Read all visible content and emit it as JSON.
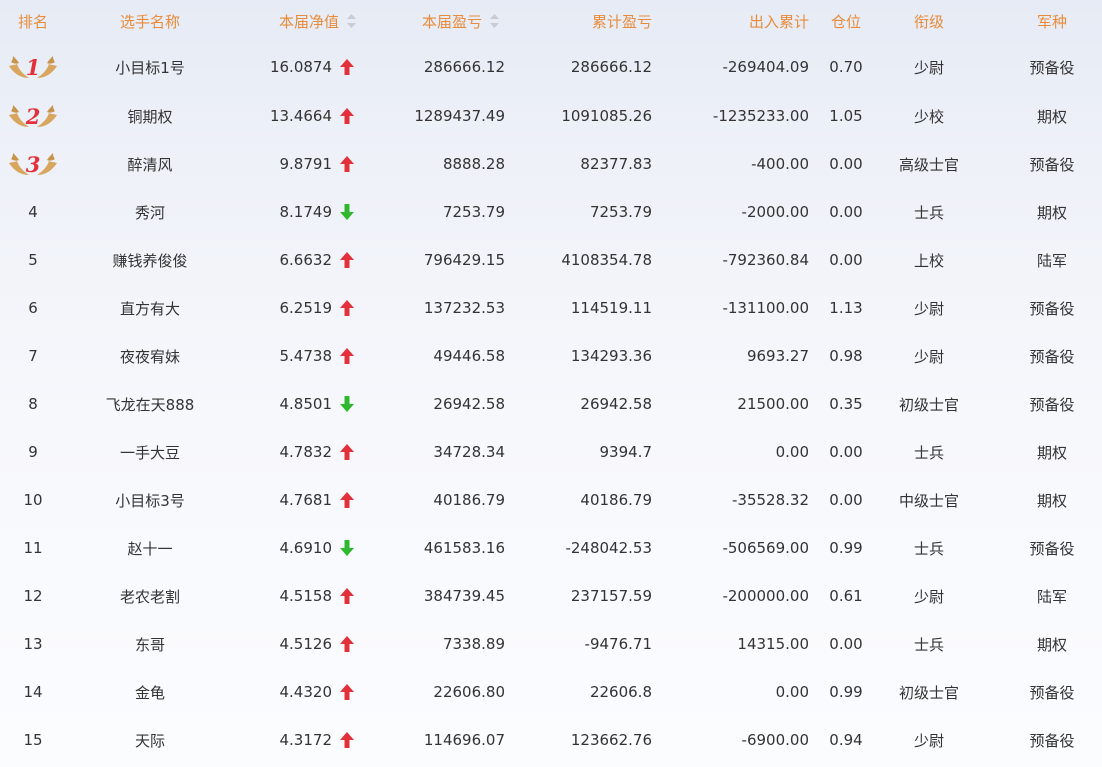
{
  "header": {
    "rank": "排名",
    "name": "选手名称",
    "nav": "本届净值",
    "profit": "本届盈亏",
    "cumulative": "累计盈亏",
    "flow": "出入累计",
    "position": "仓位",
    "title": "衔级",
    "branch": "军种"
  },
  "colors": {
    "header_text": "#e88c3c",
    "up": "#e3313b",
    "down": "#2eb82e",
    "medal": "#d4a45c"
  },
  "rows": [
    {
      "rank": "1",
      "name": "小目标1号",
      "nav": "16.0874",
      "trend": "up",
      "profit": "286666.12",
      "cumulative": "286666.12",
      "flow": "-269404.09",
      "position": "0.70",
      "title": "少尉",
      "branch": "预备役"
    },
    {
      "rank": "2",
      "name": "铜期权",
      "nav": "13.4664",
      "trend": "up",
      "profit": "1289437.49",
      "cumulative": "1091085.26",
      "flow": "-1235233.00",
      "position": "1.05",
      "title": "少校",
      "branch": "期权"
    },
    {
      "rank": "3",
      "name": "醉清风",
      "nav": "9.8791",
      "trend": "up",
      "profit": "8888.28",
      "cumulative": "82377.83",
      "flow": "-400.00",
      "position": "0.00",
      "title": "高级士官",
      "branch": "预备役"
    },
    {
      "rank": "4",
      "name": "秀河",
      "nav": "8.1749",
      "trend": "down",
      "profit": "7253.79",
      "cumulative": "7253.79",
      "flow": "-2000.00",
      "position": "0.00",
      "title": "士兵",
      "branch": "期权"
    },
    {
      "rank": "5",
      "name": "赚钱养俊俊",
      "nav": "6.6632",
      "trend": "up",
      "profit": "796429.15",
      "cumulative": "4108354.78",
      "flow": "-792360.84",
      "position": "0.00",
      "title": "上校",
      "branch": "陆军"
    },
    {
      "rank": "6",
      "name": "直方有大",
      "nav": "6.2519",
      "trend": "up",
      "profit": "137232.53",
      "cumulative": "114519.11",
      "flow": "-131100.00",
      "position": "1.13",
      "title": "少尉",
      "branch": "预备役"
    },
    {
      "rank": "7",
      "name": "夜夜宥妹",
      "nav": "5.4738",
      "trend": "up",
      "profit": "49446.58",
      "cumulative": "134293.36",
      "flow": "9693.27",
      "position": "0.98",
      "title": "少尉",
      "branch": "预备役"
    },
    {
      "rank": "8",
      "name": "飞龙在天888",
      "nav": "4.8501",
      "trend": "down",
      "profit": "26942.58",
      "cumulative": "26942.58",
      "flow": "21500.00",
      "position": "0.35",
      "title": "初级士官",
      "branch": "预备役"
    },
    {
      "rank": "9",
      "name": "一手大豆",
      "nav": "4.7832",
      "trend": "up",
      "profit": "34728.34",
      "cumulative": "9394.7",
      "flow": "0.00",
      "position": "0.00",
      "title": "士兵",
      "branch": "期权"
    },
    {
      "rank": "10",
      "name": "小目标3号",
      "nav": "4.7681",
      "trend": "up",
      "profit": "40186.79",
      "cumulative": "40186.79",
      "flow": "-35528.32",
      "position": "0.00",
      "title": "中级士官",
      "branch": "期权"
    },
    {
      "rank": "11",
      "name": "赵十一",
      "nav": "4.6910",
      "trend": "down",
      "profit": "461583.16",
      "cumulative": "-248042.53",
      "flow": "-506569.00",
      "position": "0.99",
      "title": "士兵",
      "branch": "预备役"
    },
    {
      "rank": "12",
      "name": "老农老割",
      "nav": "4.5158",
      "trend": "up",
      "profit": "384739.45",
      "cumulative": "237157.59",
      "flow": "-200000.00",
      "position": "0.61",
      "title": "少尉",
      "branch": "陆军"
    },
    {
      "rank": "13",
      "name": "东哥",
      "nav": "4.5126",
      "trend": "up",
      "profit": "7338.89",
      "cumulative": "-9476.71",
      "flow": "14315.00",
      "position": "0.00",
      "title": "士兵",
      "branch": "期权"
    },
    {
      "rank": "14",
      "name": "金龟",
      "nav": "4.4320",
      "trend": "up",
      "profit": "22606.80",
      "cumulative": "22606.8",
      "flow": "0.00",
      "position": "0.99",
      "title": "初级士官",
      "branch": "预备役"
    },
    {
      "rank": "15",
      "name": "天际",
      "nav": "4.3172",
      "trend": "up",
      "profit": "114696.07",
      "cumulative": "123662.76",
      "flow": "-6900.00",
      "position": "0.94",
      "title": "少尉",
      "branch": "预备役"
    }
  ]
}
